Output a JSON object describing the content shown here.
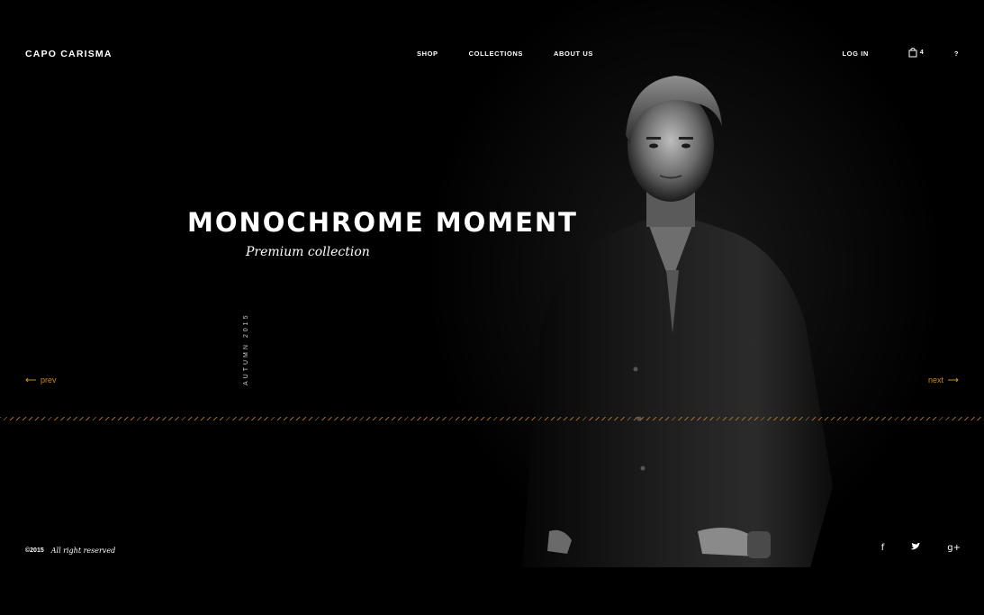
{
  "brand": {
    "name": "CAPO CARISMA"
  },
  "nav": {
    "items": [
      "SHOP",
      "COLLECTIONS",
      "ABOUT US"
    ]
  },
  "account": {
    "login_label": "LOG IN",
    "cart_count": "4",
    "help_label": "?"
  },
  "hero": {
    "title": "MONOCHROME MOMENT",
    "subtitle": "Premium collection",
    "season": "AUTUMN 2015"
  },
  "slider": {
    "prev_label": "prev",
    "next_label": "next",
    "accent_color": "#c98a2b"
  },
  "footer": {
    "year": "©2015",
    "rights": "All right reserved",
    "social": [
      {
        "icon": "facebook-icon",
        "glyph": "f"
      },
      {
        "icon": "twitter-icon",
        "glyph": "t"
      },
      {
        "icon": "google-plus-icon",
        "glyph": "g+"
      }
    ]
  }
}
